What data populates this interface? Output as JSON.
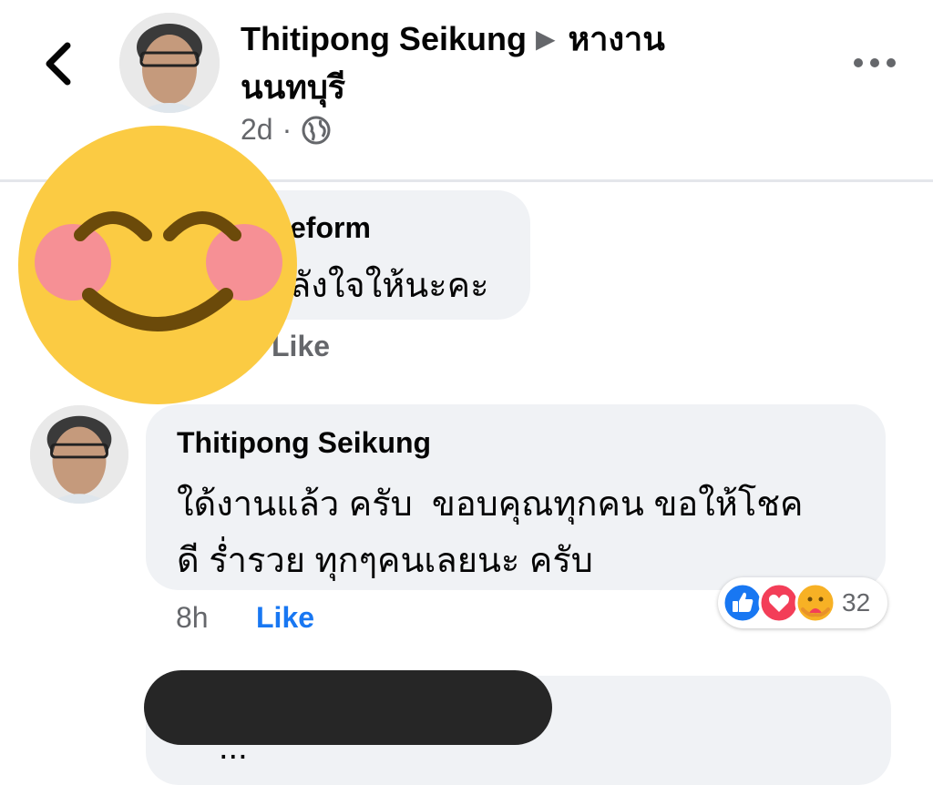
{
  "header": {
    "author": "Thitipong Seikung",
    "group": "หางาน",
    "group_line2": "นนทบุรี",
    "time": "2d",
    "separator": "·"
  },
  "comments": [
    {
      "name_partial": "eform",
      "text_partial": "ลังใจให้นะคะ",
      "like_label": "Like"
    },
    {
      "name": "Thitipong Seikung",
      "line1": "ใด้งานแล้ว ครับ  ขอบคุณทุกคน ขอให้โชค",
      "line2": "ดี ร่ำรวย ทุกๆคนเลยนะ ครับ",
      "time": "8h",
      "like_label": "Like",
      "reaction_count": "32",
      "reactions": [
        "like-icon",
        "love-icon",
        "care-icon"
      ]
    }
  ],
  "third_comment_partial": "...",
  "colors": {
    "accent": "#1877f2",
    "bubble": "#f0f2f5",
    "muted": "#65676b",
    "love": "#f33e58",
    "emoji_face": "#fbcb43"
  }
}
